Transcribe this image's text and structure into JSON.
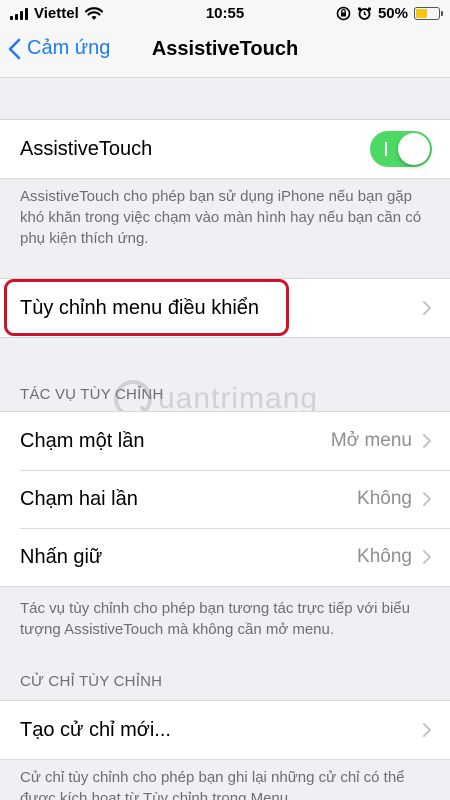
{
  "status_bar": {
    "carrier": "Viettel",
    "time": "10:55",
    "battery_percent": "50%",
    "battery_level": 0.5
  },
  "nav": {
    "back_label": "Cảm ứng",
    "title": "AssistiveTouch"
  },
  "main_toggle": {
    "label": "AssistiveTouch",
    "on": true
  },
  "main_description": "AssistiveTouch cho phép bạn sử dụng iPhone nếu bạn gặp khó khăn trong việc chạm vào màn hình hay nếu bạn cần có phụ kiện thích ứng.",
  "customize_menu": {
    "label": "Tùy chỉnh menu điều khiển"
  },
  "custom_actions": {
    "header": "TÁC VỤ TÙY CHỈNH",
    "items": [
      {
        "label": "Chạm một lần",
        "value": "Mở menu"
      },
      {
        "label": "Chạm hai lần",
        "value": "Không"
      },
      {
        "label": "Nhấn giữ",
        "value": "Không"
      }
    ],
    "footer": "Tác vụ tùy chỉnh cho phép bạn tương tác trực tiếp với biểu tượng AssistiveTouch mà không cần mở menu."
  },
  "custom_gestures": {
    "header": "CỬ CHỈ TÙY CHỈNH",
    "create_label": "Tạo cử chỉ mới...",
    "footer": "Cử chỉ tùy chỉnh cho phép bạn ghi lại những cử chỉ có thể được kích hoạt từ Tùy chỉnh trong Menu."
  },
  "watermark": {
    "text": "uantrimang"
  },
  "colors": {
    "accent": "#1e7cf2",
    "toggle_on": "#4cd964",
    "highlight": "#d0112b",
    "battery": "#f5c518"
  }
}
